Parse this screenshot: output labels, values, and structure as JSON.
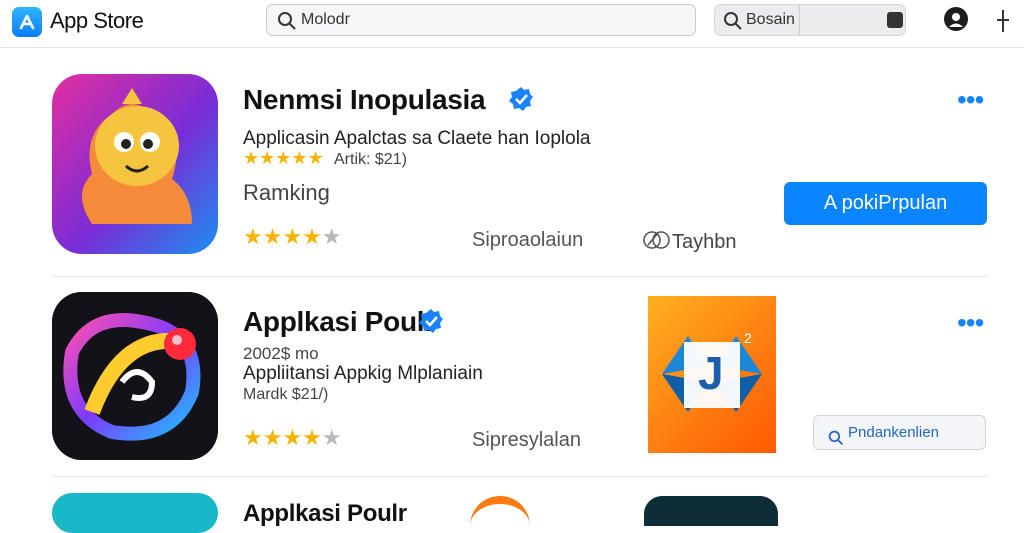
{
  "header": {
    "app_name": "App Store",
    "search_text": "Molodr",
    "side_search_text": "Bosain"
  },
  "apps": [
    {
      "title": "Nenmsi Inopulasia",
      "subtitle": "Applicasin Apalctas sa Claete han Ioplola",
      "rating_note": "Artik: $21)",
      "ranking_label": "Ramking",
      "rating": 4,
      "meta_left": "Siproaolaiun",
      "meta_right": "Tayhbn",
      "action_label": "A pokiPrpulan"
    },
    {
      "title": "Applkasi Poulr",
      "line1": "2002$ mo",
      "line2": "Appliitansi Appkig Mlplaniain",
      "line3": "Mardk $21/)",
      "rating": 4,
      "meta_left": "Sipresylalan",
      "promo_text": "J",
      "promo_sup": "2",
      "action_label": "Pndankenlien"
    },
    {
      "title": "Applkasi Poulr"
    }
  ],
  "colors": {
    "accent": "#0a84ff",
    "star": "#f5b400",
    "verified": "#1783ff"
  }
}
